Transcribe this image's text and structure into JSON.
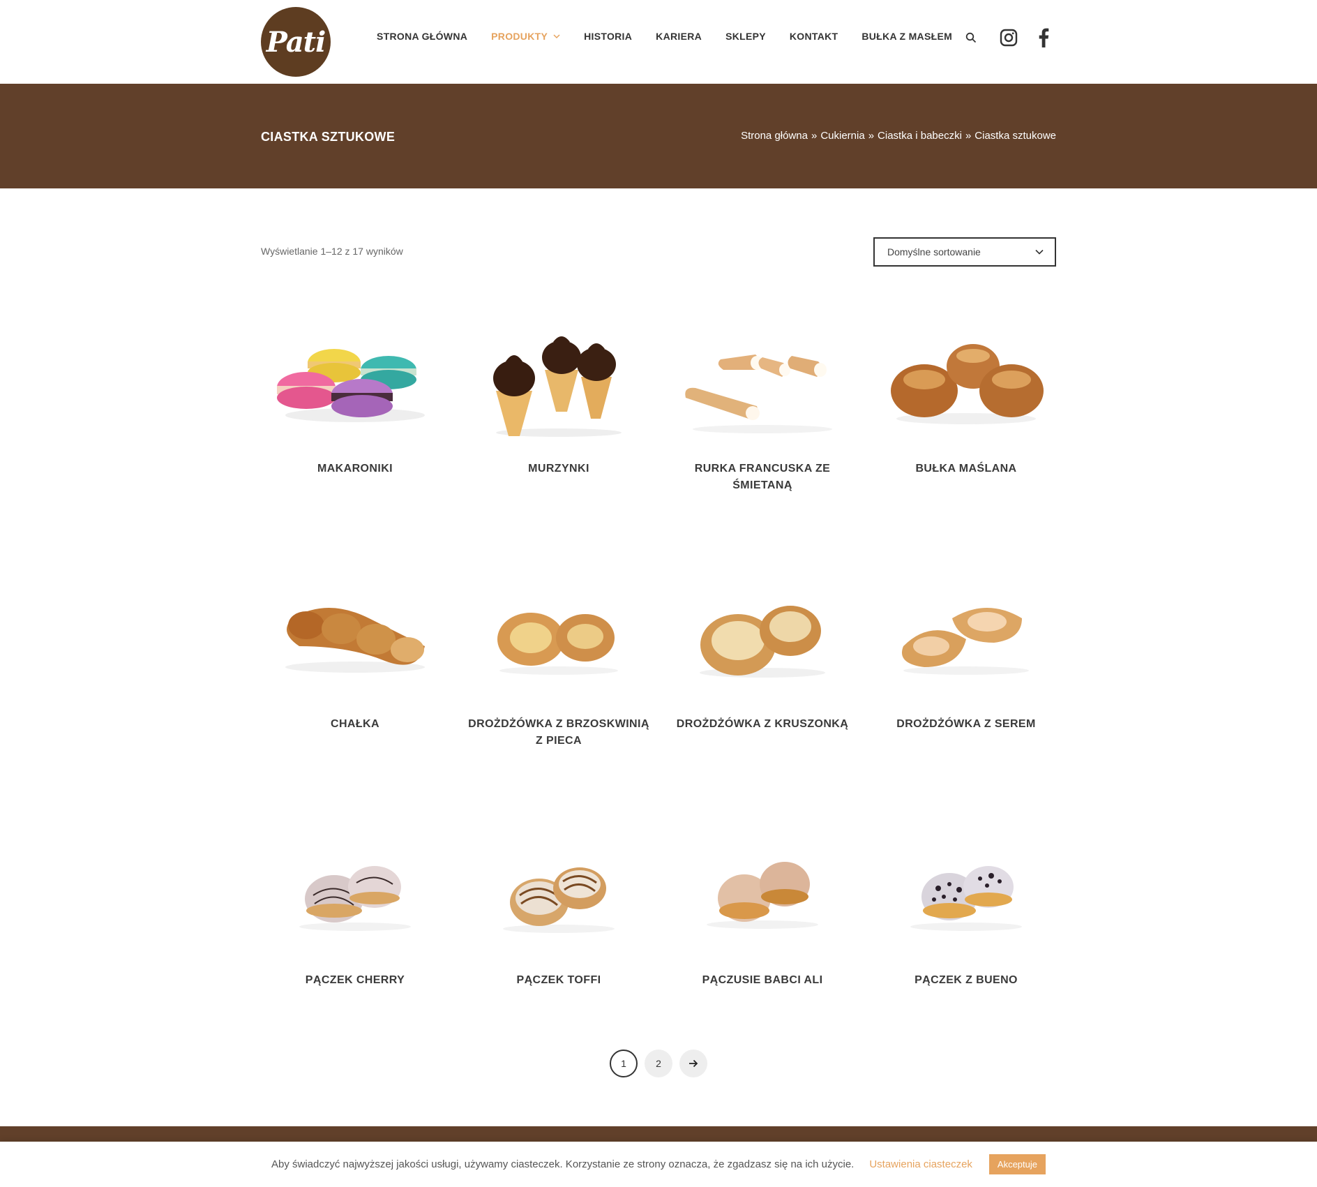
{
  "header": {
    "logo_text": "Pati",
    "nav": [
      {
        "label": "STRONA GŁÓWNA",
        "active": false
      },
      {
        "label": "PRODUKTY",
        "active": true
      },
      {
        "label": "HISTORIA",
        "active": false
      },
      {
        "label": "KARIERA",
        "active": false
      },
      {
        "label": "SKLEPY",
        "active": false
      },
      {
        "label": "KONTAKT",
        "active": false
      },
      {
        "label": "BUŁKA Z MASŁEM",
        "active": false
      }
    ],
    "icons": [
      "search-icon",
      "instagram-icon",
      "facebook-icon"
    ]
  },
  "banner": {
    "title": "CIASTKA SZTUKOWE",
    "breadcrumb": [
      {
        "label": "Strona główna"
      },
      {
        "label": "Cukiernia"
      },
      {
        "label": "Ciastka i babeczki"
      },
      {
        "label": "Ciastka sztukowe"
      }
    ],
    "separator": "»"
  },
  "toolbar": {
    "result_count": "Wyświetlanie 1–12 z 17 wyników",
    "sort_selected": "Domyślne sortowanie"
  },
  "products": [
    {
      "name": "MAKARONIKI"
    },
    {
      "name": "MURZYNKI"
    },
    {
      "name": "RURKA FRANCUSKA ZE ŚMIETANĄ"
    },
    {
      "name": "BUŁKA MAŚLANA"
    },
    {
      "name": "CHAŁKA"
    },
    {
      "name": "DROŻDŻÓWKA Z BRZOSKWINIĄ Z PIECA"
    },
    {
      "name": "DROŻDŻÓWKA Z KRUSZONKĄ"
    },
    {
      "name": "DROŻDŻÓWKA Z SEREM"
    },
    {
      "name": "PĄCZEK CHERRY"
    },
    {
      "name": "PĄCZEK TOFFI"
    },
    {
      "name": "PĄCZUSIE BABCI ALI"
    },
    {
      "name": "PĄCZEK Z BUENO"
    }
  ],
  "pagination": {
    "pages": [
      "1",
      "2"
    ],
    "current": "1",
    "next_icon": "arrow-right-icon"
  },
  "cookie": {
    "text": "Aby świadczyć najwyższej jakości usługi, używamy ciasteczek. Korzystanie ze strony oznacza, że zgadzasz się na ich użycie.",
    "settings_link": "Ustawienia ciasteczek",
    "accept_button": "Akceptuje"
  },
  "colors": {
    "brown": "#61402a",
    "accent": "#e6a35e"
  }
}
